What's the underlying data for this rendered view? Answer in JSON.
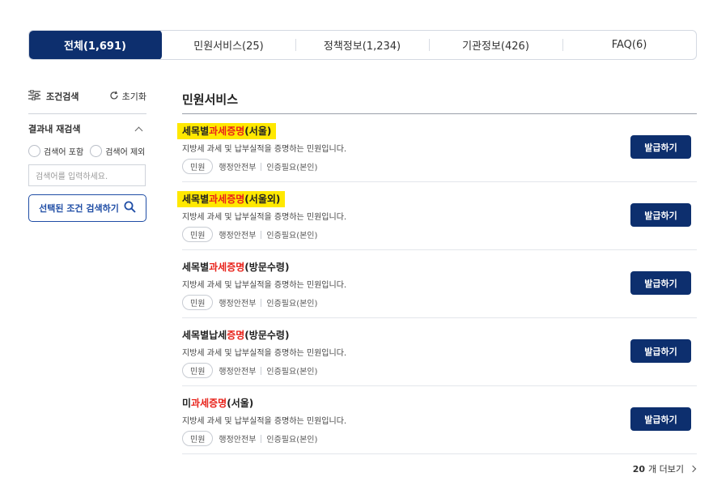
{
  "tabs": [
    {
      "label": "전체(1,691)",
      "active": true
    },
    {
      "label": "민원서비스(25)",
      "active": false
    },
    {
      "label": "정책정보(1,234)",
      "active": false
    },
    {
      "label": "기관정보(426)",
      "active": false
    },
    {
      "label": "FAQ(6)",
      "active": false
    }
  ],
  "filter": {
    "title": "조건검색",
    "reset": "초기화",
    "refine_title": "결과내 재검색",
    "radio_include": "검색어 포함",
    "radio_exclude": "검색어 제외",
    "search_placeholder": "검색어를 입력하세요.",
    "search_button": "선택된 조건 검색하기"
  },
  "section_title": "민원서비스",
  "results": [
    {
      "title_pre": "세목별",
      "title_kw": "과세증명",
      "title_post": "(서울)",
      "highlighted": true,
      "desc": "지방세 과세 및 납부실적을 증명하는 민원입니다.",
      "tag": "민원",
      "agency": "행정안전부",
      "auth": "인증필요(본인)",
      "button": "발급하기"
    },
    {
      "title_pre": "세목별",
      "title_kw": "과세증명",
      "title_post": "(서울외)",
      "highlighted": true,
      "desc": "지방세 과세 및 납부실적을 증명하는 민원입니다.",
      "tag": "민원",
      "agency": "행정안전부",
      "auth": "인증필요(본인)",
      "button": "발급하기"
    },
    {
      "title_pre": "세목별",
      "title_kw": "과세증명",
      "title_post": "(방문수령)",
      "highlighted": false,
      "desc": "지방세 과세 및 납부실적을 증명하는 민원입니다.",
      "tag": "민원",
      "agency": "행정안전부",
      "auth": "인증필요(본인)",
      "button": "발급하기"
    },
    {
      "title_pre": "세목별납세",
      "title_kw": "증명",
      "title_post": "(방문수령)",
      "highlighted": false,
      "desc": "지방세 과세 및 납부실적을 증명하는 민원입니다.",
      "tag": "민원",
      "agency": "행정안전부",
      "auth": "인증필요(본인)",
      "button": "발급하기"
    },
    {
      "title_pre": "미",
      "title_kw": "과세증명",
      "title_post": "(서울)",
      "highlighted": false,
      "desc": "지방세 과세 및 납부실적을 증명하는 민원입니다.",
      "tag": "민원",
      "agency": "행정안전부",
      "auth": "인증필요(본인)",
      "button": "발급하기"
    }
  ],
  "more": {
    "count": "20",
    "label": "개 더보기"
  },
  "colors": {
    "primary": "#0d2f6e",
    "accent_blue": "#1f4da5",
    "keyword": "#e8221a",
    "highlight": "#ffe800"
  }
}
